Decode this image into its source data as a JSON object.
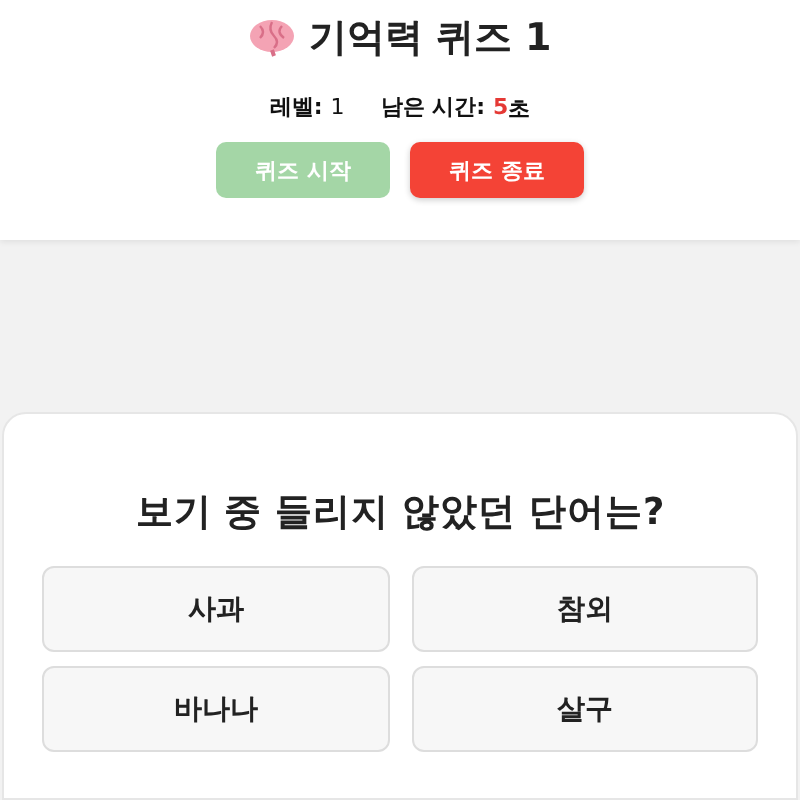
{
  "header": {
    "title": "기억력 퀴즈 1",
    "level_label": "레벨:",
    "level_value": "1",
    "timer_label": "남은 시간:",
    "timer_value": "5",
    "timer_unit": "초"
  },
  "buttons": [
    {
      "label": "퀴즈 시작",
      "kind": "start",
      "disabled": true
    },
    {
      "label": "퀴즈 종료",
      "kind": "stop",
      "disabled": false
    }
  ],
  "question": {
    "text": "보기 중 들리지 않았던 단어는?",
    "options": [
      {
        "label": "사과"
      },
      {
        "label": "참외"
      },
      {
        "label": "바나나"
      },
      {
        "label": "살구"
      }
    ]
  }
}
